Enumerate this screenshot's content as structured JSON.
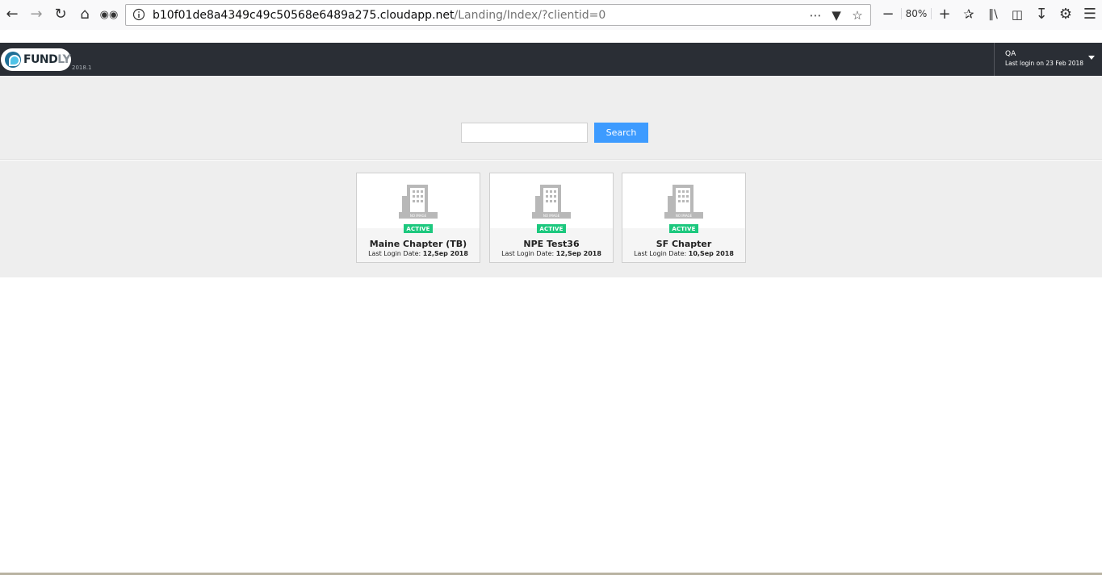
{
  "browser": {
    "url_host": "b10f01de8a4349c49c50568e6489a275.cloudapp.net",
    "url_path": "/Landing/Index/?clientid=0",
    "zoom": "80%"
  },
  "header": {
    "logo_text_main": "FUND",
    "logo_text_accent": "LY",
    "version": "2018.1",
    "user_name": "QA",
    "last_login": "Last login on 23 Feb 2018"
  },
  "search": {
    "value": "",
    "placeholder": "",
    "button_label": "Search"
  },
  "cards": [
    {
      "status": "ACTIVE",
      "title": "Maine Chapter (TB)",
      "date_label": "Last Login Date:",
      "date_value": "12,Sep 2018",
      "image_text": "NO IMAGE"
    },
    {
      "status": "ACTIVE",
      "title": "NPE Test36",
      "date_label": "Last Login Date:",
      "date_value": "12,Sep 2018",
      "image_text": "NO IMAGE"
    },
    {
      "status": "ACTIVE",
      "title": "SF Chapter",
      "date_label": "Last Login Date:",
      "date_value": "10,Sep 2018",
      "image_text": "NO IMAGE"
    }
  ],
  "colors": {
    "header_bg": "#2a2e35",
    "search_button": "#3d9bff",
    "active_badge": "#1cc87e"
  }
}
